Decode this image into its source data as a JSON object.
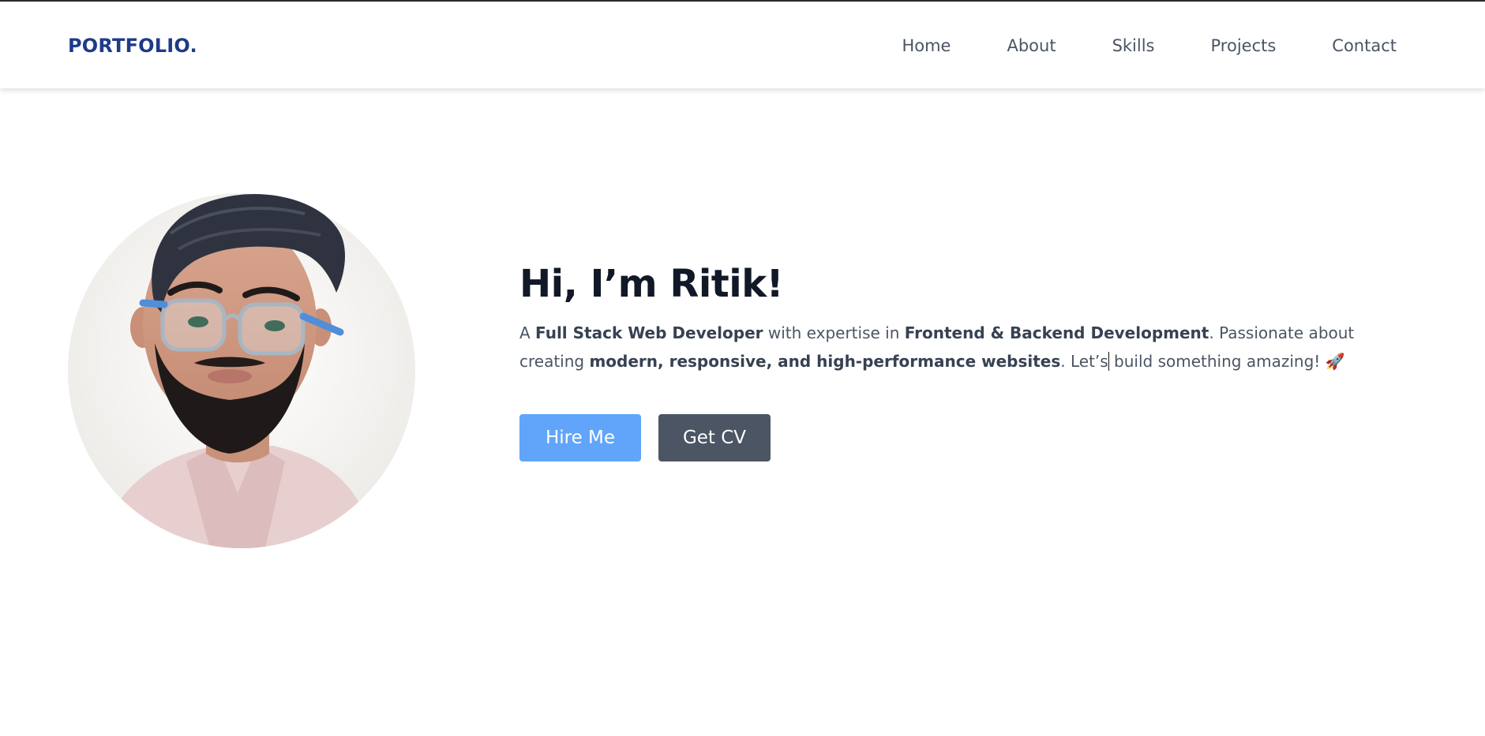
{
  "navbar": {
    "brand": "PORTFOLIO.",
    "links": [
      "Home",
      "About",
      "Skills",
      "Projects",
      "Contact"
    ]
  },
  "hero": {
    "heading": "Hi, I’m Ritik!",
    "intro_prefix": "A ",
    "intro_bold_1": "Full Stack Web Developer",
    "intro_mid_1": " with expertise in ",
    "intro_bold_2": "Frontend & Backend Development",
    "intro_mid_2": ". Passionate about creating ",
    "intro_bold_3": "modern, responsive, and high-performance websites",
    "intro_mid_3": ". Let’s",
    "intro_suffix": " build something amazing! ",
    "intro_emoji": "🚀",
    "hire_label": "Hire Me",
    "cv_label": "Get CV"
  },
  "colors": {
    "brand": "#1e3a8a",
    "primary_button": "#60a5fa",
    "secondary_button": "#4b5563"
  },
  "icons": {
    "profile": "profile-photo"
  }
}
